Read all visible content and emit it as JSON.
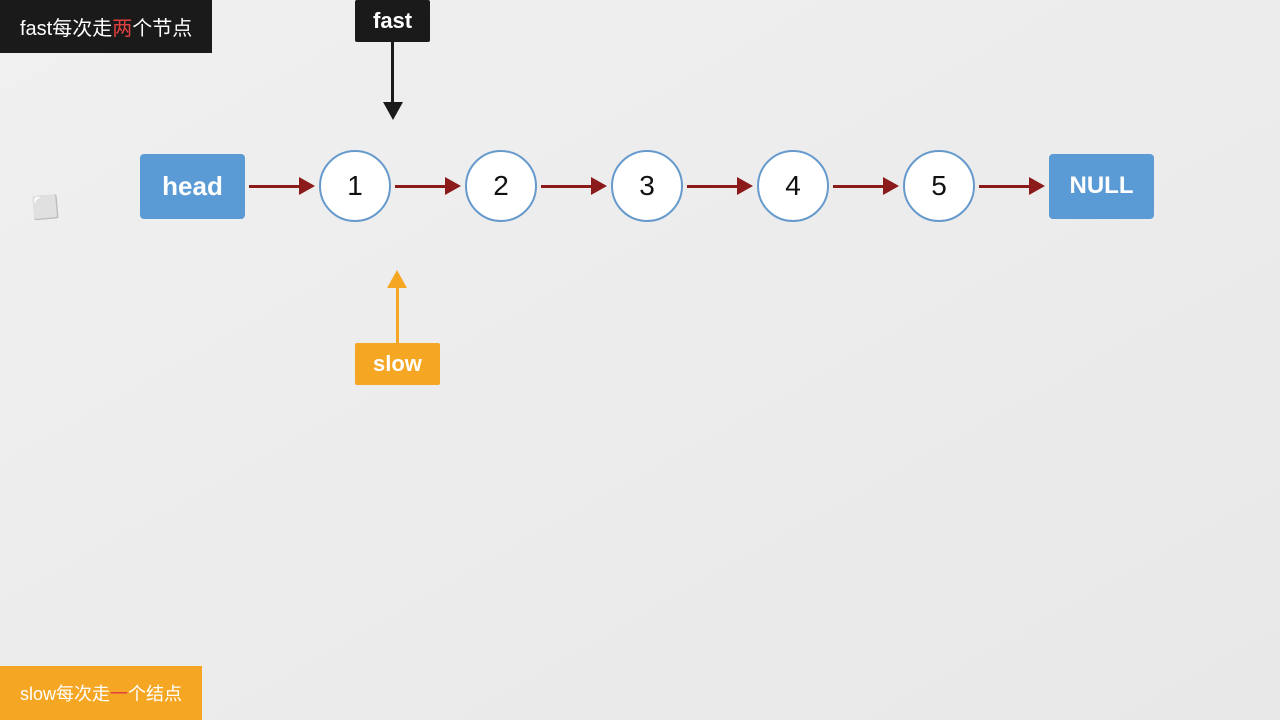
{
  "top_banner": {
    "text_before": "fast每次走",
    "highlight": "两",
    "text_after": "个节点"
  },
  "bottom_banner": {
    "text_before": "slow每次走",
    "highlight": "一",
    "text_after": "个结点"
  },
  "fast_label": "fast",
  "slow_label": "slow",
  "head_label": "head",
  "null_label": "NULL",
  "nodes": [
    "1",
    "2",
    "3",
    "4",
    "5"
  ]
}
